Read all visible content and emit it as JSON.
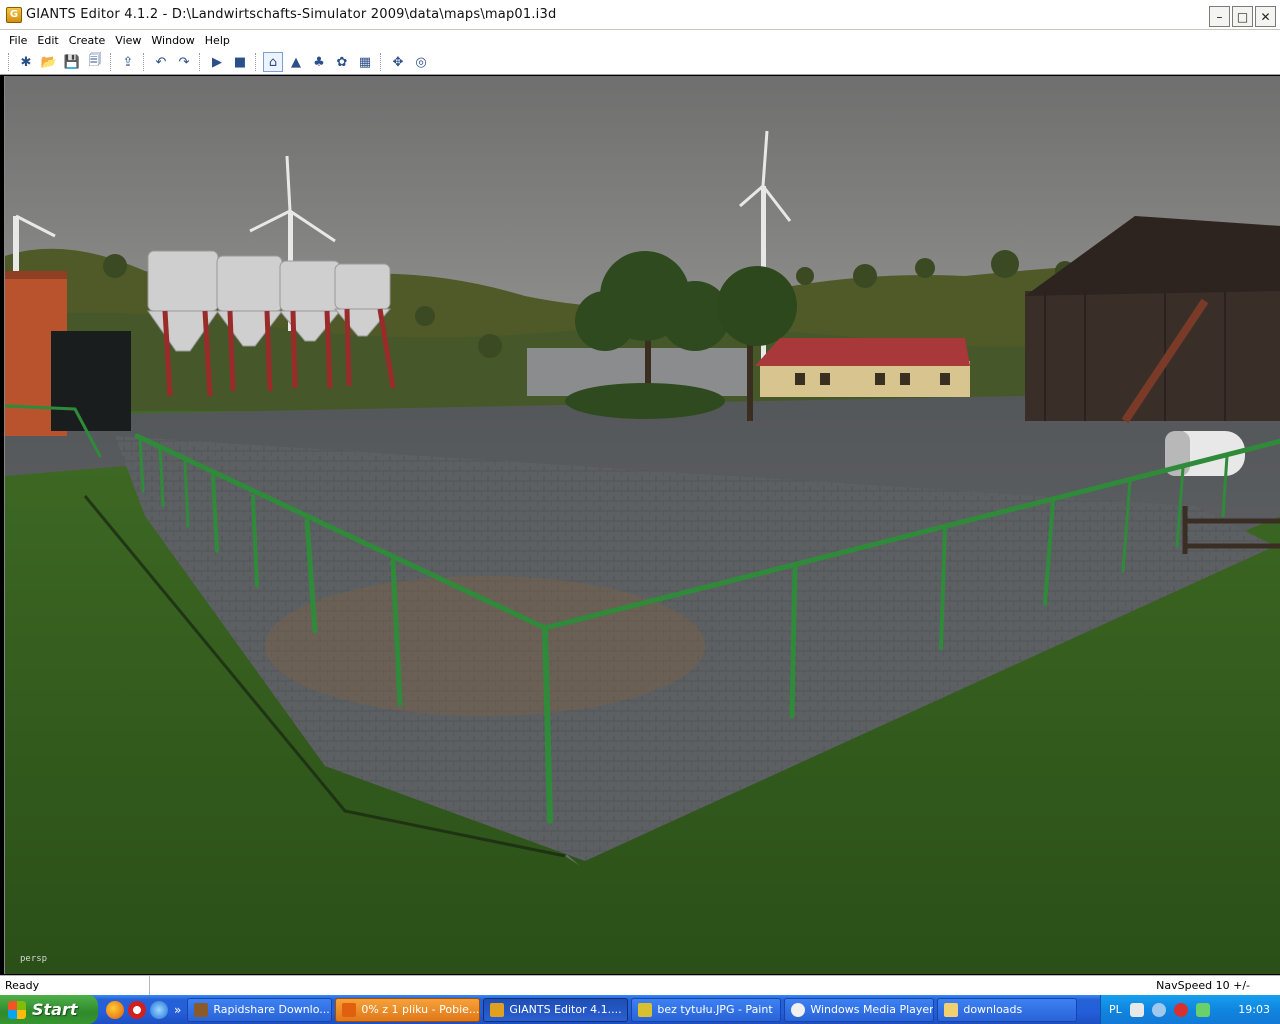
{
  "window": {
    "title": "GIANTS Editor 4.1.2 - D:\\Landwirtschafts-Simulator 2009\\data\\maps\\map01.i3d",
    "app_icon_letter": "G",
    "controls": {
      "minimize": "–",
      "maximize": "□",
      "close": "✕"
    }
  },
  "menu": {
    "items": [
      "File",
      "Edit",
      "Create",
      "View",
      "Window",
      "Help"
    ]
  },
  "toolbar": {
    "icons": [
      "new-icon",
      "open-icon",
      "save-icon",
      "save-all-icon",
      "import-icon",
      "undo-icon",
      "redo-icon",
      "play-icon",
      "stop-icon",
      "home-icon",
      "terrain-icon",
      "foliage-icon",
      "grass-icon",
      "paint-icon",
      "select-icon",
      "gizmo-icon"
    ],
    "glyphs": [
      "✱",
      "📂",
      "💾",
      "🗐",
      "⇪",
      "↶",
      "↷",
      "▶",
      "■",
      "⌂",
      "▲",
      "♣",
      "✿",
      "▦",
      "✥",
      "◎"
    ]
  },
  "viewport": {
    "camera_label": "persp"
  },
  "statusbar": {
    "status": "Ready",
    "navspeed": "NavSpeed 10 +/-"
  },
  "taskbar": {
    "start_label": "Start",
    "quicklaunch_more": "»",
    "tasks": [
      {
        "label": "Rapidshare Downlo...",
        "state": "normal",
        "icon_color": "#8a5a2a"
      },
      {
        "label": "0% z 1 pliku - Pobie...",
        "state": "active",
        "icon_color": "#e06010"
      },
      {
        "label": "GIANTS Editor 4.1....",
        "state": "pressed",
        "icon_color": "#e0a020"
      },
      {
        "label": "bez tytułu.JPG - Paint",
        "state": "normal",
        "icon_color": "#d8c030"
      },
      {
        "label": "Windows Media Player",
        "state": "normal",
        "icon_color": "#f0f0f0"
      },
      {
        "label": "downloads",
        "state": "normal",
        "icon_color": "#f0d070"
      }
    ],
    "tray": {
      "language": "PL",
      "clock": "19:03"
    }
  },
  "colors": {
    "sky": "#7f7f7f",
    "grass": "#2f5a1c",
    "fence": "#2f8a3a",
    "pavement": "#5a5d60"
  }
}
